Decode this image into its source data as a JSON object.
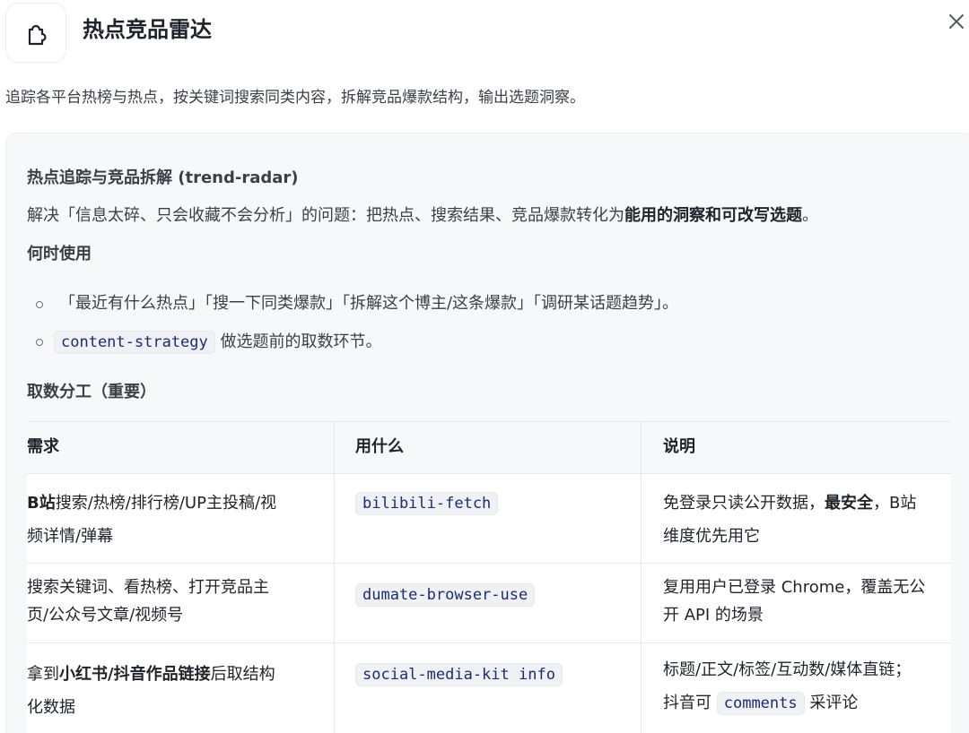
{
  "header": {
    "title": "热点竞品雷达",
    "icon": "puzzle-icon",
    "close_icon": "close-icon"
  },
  "description": "追踪各平台热榜与热点，按关键词搜索同类内容，拆解竞品爆款结构，输出选题洞察。",
  "skill": {
    "heading": "热点追踪与竞品拆解 (trend-radar)",
    "intro_prefix": "解决「信息太碎、只会收藏不会分析」的问题：把热点、搜索结果、竞品爆款转化为",
    "intro_bold": "能用的洞察和可改写选题",
    "intro_suffix": "。",
    "when_heading": "何时使用",
    "when_items": [
      {
        "text": "「最近有什么热点」「搜一下同类爆款」「拆解这个博主/这条爆款」「调研某话题趋势」。"
      },
      {
        "code": "content-strategy",
        "text": " 做选题前的取数环节。"
      }
    ],
    "split_heading": "取数分工（重要）"
  },
  "table": {
    "headers": [
      "需求",
      "用什么",
      "说明"
    ],
    "rows": [
      {
        "need_parts": [
          {
            "t": "B站",
            "b": true
          },
          {
            "t": "搜索/热榜/排行榜/UP主投稿/视",
            "b": false
          }
        ],
        "need_line2": "频详情/弹幕",
        "tool": "bilibili-fetch",
        "note_parts": [
          {
            "t": "免登录只读公开数据，",
            "b": false
          },
          {
            "t": "最安全",
            "b": true
          },
          {
            "t": "，B站",
            "b": false
          }
        ],
        "note_line2": "维度优先用它"
      },
      {
        "need_line1": "搜索关键词、看热榜、打开竞品主",
        "need_line2": "页/公众号文章/视频号",
        "tool": "dumate-browser-use",
        "note_line1": "复用用户已登录 Chrome，覆盖无公",
        "note_line2": "开 API 的场景"
      },
      {
        "need_parts": [
          {
            "t": "拿到",
            "b": false
          },
          {
            "t": "小红书/抖音作品链接",
            "b": true
          },
          {
            "t": "后取结构",
            "b": false
          }
        ],
        "need_line2": "化数据",
        "tool": "social-media-kit info",
        "note_line1": "标题/正文/标签/互动数/媒体直链；",
        "note_prefix2": "抖音可 ",
        "note_code2": "comments",
        "note_suffix2": " 采评论"
      }
    ]
  }
}
